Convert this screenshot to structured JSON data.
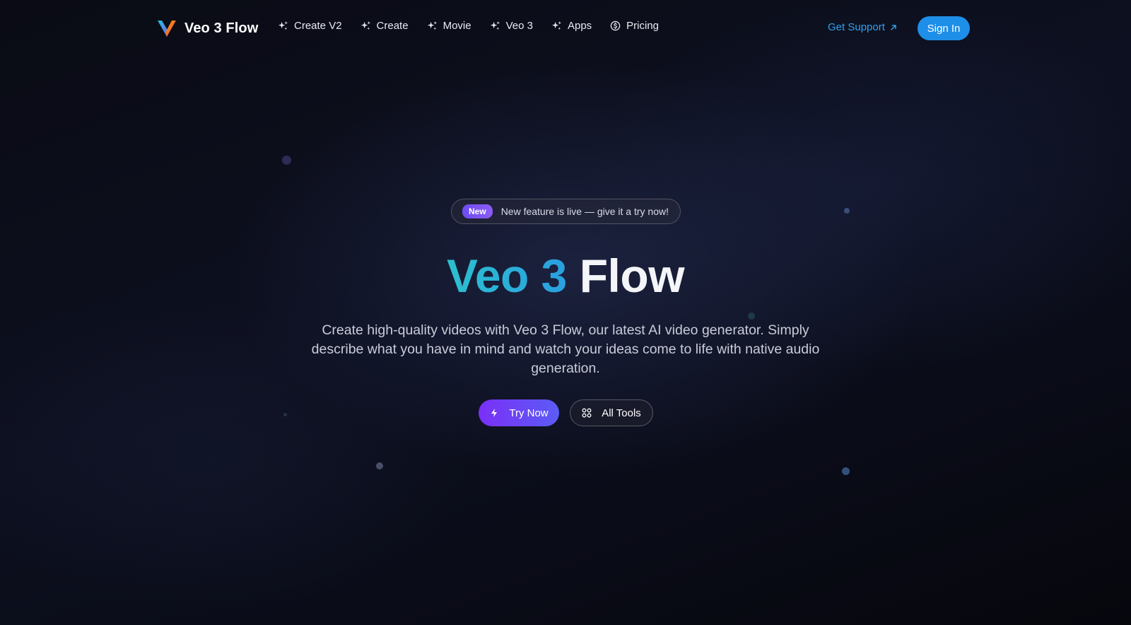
{
  "brand": {
    "name": "Veo 3 Flow"
  },
  "nav": {
    "items": [
      {
        "label": "Create V2",
        "icon": "sparkles-icon"
      },
      {
        "label": "Create",
        "icon": "sparkles-icon"
      },
      {
        "label": "Movie",
        "icon": "sparkles-icon"
      },
      {
        "label": "Veo 3",
        "icon": "sparkles-icon"
      },
      {
        "label": "Apps",
        "icon": "sparkles-icon"
      },
      {
        "label": "Pricing",
        "icon": "dollar-circle-icon"
      }
    ],
    "support_label": "Get Support",
    "signin_label": "Sign In"
  },
  "hero": {
    "badge": "New",
    "announcement": "New feature is live — give it a try now!",
    "title_accent": "Veo 3",
    "title_plain": "Flow",
    "subtitle": "Create high-quality videos with Veo 3 Flow, our latest AI video generator. Simply describe what you have in mind and watch your ideas come to life with native audio generation.",
    "primary_button": "Try Now",
    "secondary_button": "All Tools"
  },
  "colors": {
    "background": "#07080f",
    "accent_blue": "#1e8fe8",
    "link_blue": "#2ea3ee",
    "title_gradient_start": "#2cc0cf",
    "title_gradient_end": "#2a9fe0",
    "primary_gradient_start": "#7b2ff7",
    "primary_gradient_end": "#5b5cf6"
  }
}
